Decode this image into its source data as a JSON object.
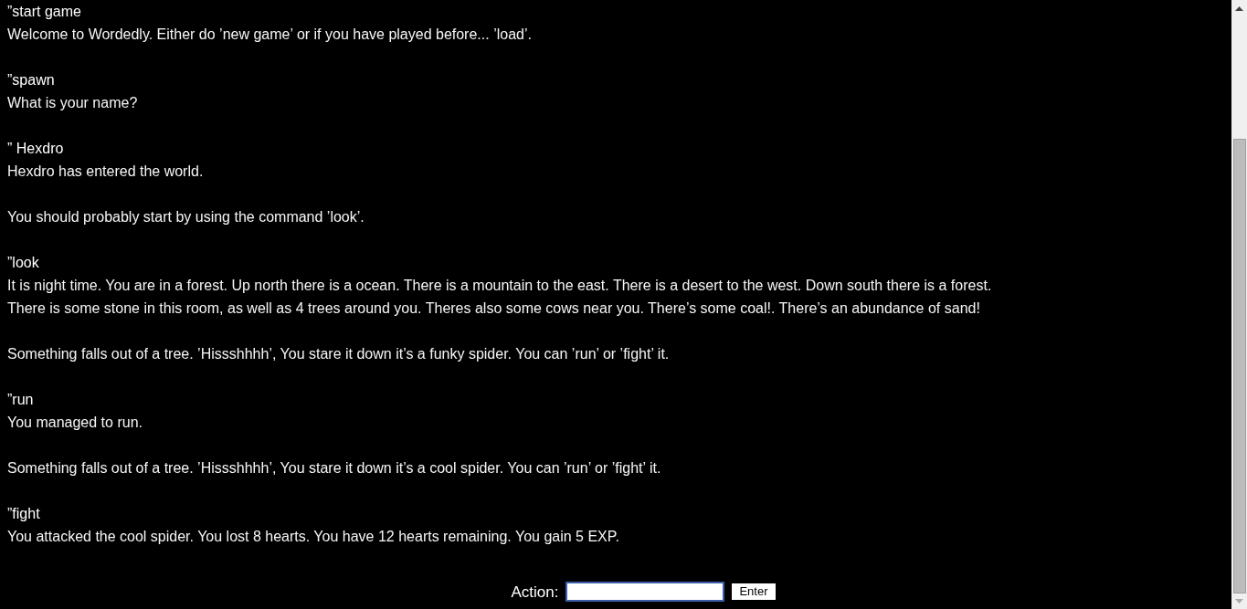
{
  "log": [
    {
      "lines": [
        {
          "kind": "command",
          "text": "”start game"
        },
        {
          "kind": "response",
          "text": "Welcome to Wordedly. Either do ’new game’ or if you have played before... ’load’."
        }
      ]
    },
    {
      "lines": [
        {
          "kind": "command",
          "text": "”spawn"
        },
        {
          "kind": "response",
          "text": "What is your name?"
        }
      ]
    },
    {
      "lines": [
        {
          "kind": "command",
          "text": "” Hexdro"
        },
        {
          "kind": "response",
          "text": "Hexdro has entered the world."
        }
      ]
    },
    {
      "lines": [
        {
          "kind": "response",
          "text": "You should probably start by using the command ’look’."
        }
      ]
    },
    {
      "lines": [
        {
          "kind": "command",
          "text": "”look"
        },
        {
          "kind": "response",
          "text": "It is night time. You are in a forest. Up north there is a ocean. There is a mountain to the east. There is a desert to the west. Down south there is a forest."
        },
        {
          "kind": "response",
          "text": "There is some stone in this room, as well as 4 trees around you. Theres also some cows near you. There’s some coal!. There’s an abundance of sand!"
        }
      ]
    },
    {
      "lines": [
        {
          "kind": "response",
          "text": "Something falls out of a tree. ’Hissshhhh’, You stare it down it’s a funky spider. You can ’run’ or ’fight’ it."
        }
      ]
    },
    {
      "lines": [
        {
          "kind": "command",
          "text": "”run"
        },
        {
          "kind": "response",
          "text": "You managed to run."
        }
      ]
    },
    {
      "lines": [
        {
          "kind": "response",
          "text": "Something falls out of a tree. ’Hissshhhh’, You stare it down it’s a cool spider. You can ’run’ or ’fight’ it."
        }
      ]
    },
    {
      "lines": [
        {
          "kind": "command",
          "text": "”fight"
        },
        {
          "kind": "response",
          "text": "You attacked the cool spider. You lost 8 hearts. You have 12 hearts remaining. You gain 5 EXP."
        }
      ]
    }
  ],
  "action": {
    "label": "Action:",
    "button": "Enter"
  }
}
